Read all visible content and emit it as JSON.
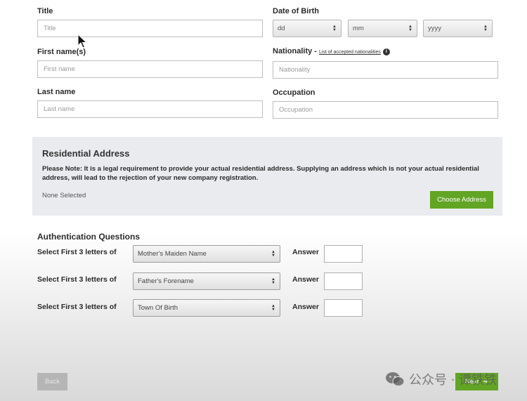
{
  "personal": {
    "title_label": "Title",
    "title_placeholder": "Title",
    "first_name_label": "First name(s)",
    "first_name_placeholder": "First name",
    "last_name_label": "Last name",
    "last_name_placeholder": "Last name",
    "dob_label": "Date of Birth",
    "dob_day": "dd",
    "dob_month": "mm",
    "dob_year": "yyyy",
    "nationality_label": "Nationality -",
    "nationality_link": "List of accepted nationalities",
    "nationality_placeholder": "Nationality",
    "occupation_label": "Occupation",
    "occupation_placeholder": "Occupation"
  },
  "address": {
    "heading": "Residential Address",
    "note": "Please Note: It is a legal requirement to provide your actual residential address. Supplying an address which is not your actual residential address, will lead to the rejection of your new company registration.",
    "status": "None Selected",
    "choose_button": "Choose Address"
  },
  "auth": {
    "heading": "Authentication Questions",
    "questions": [
      {
        "label": "Select First 3 letters of",
        "selected": "Mother's Maiden Name",
        "answer_label": "Answer"
      },
      {
        "label": "Select First 3 letters of",
        "selected": "Father's Forename",
        "answer_label": "Answer"
      },
      {
        "label": "Select First 3 letters of",
        "selected": "Town Of Birth",
        "answer_label": "Answer"
      }
    ]
  },
  "nav": {
    "back": "Back",
    "next": "Next",
    "next_arrow": "➔"
  },
  "watermark": {
    "text": "公众号 · 谭铁铁"
  },
  "colors": {
    "accent_green": "#62a524",
    "panel_bg": "#e9ebee"
  }
}
